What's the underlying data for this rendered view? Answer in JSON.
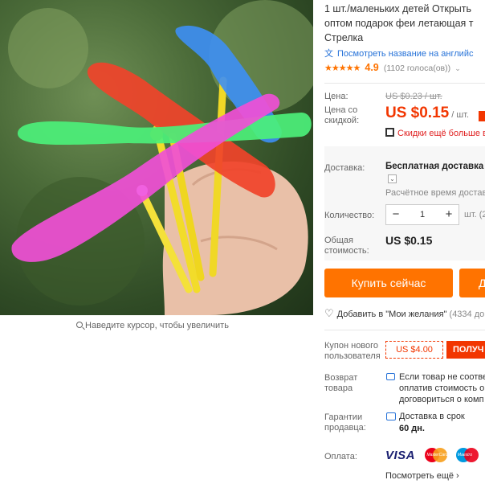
{
  "product": {
    "title_lines": [
      "1 шт./маленьких детей Открыть",
      "оптом подарок феи летающая т",
      "Стрелка"
    ],
    "translate_link": "Посмотреть название на английс",
    "rating_stars": "★★★★★",
    "rating_score": "4.9",
    "rating_votes": "(1102 голоса(ов))",
    "rating_chevron": "⌄"
  },
  "image": {
    "zoom_hint": "Наведите курсор, чтобы увеличить"
  },
  "price": {
    "label": "Цена:",
    "old": "US $0.23 / шт.",
    "discount_label": "Цена со скидкой:",
    "new": "US $0.15",
    "unit": "/ шт.",
    "qr_note": "Скидки ещё больше в"
  },
  "shipping": {
    "label": "Доставка:",
    "value": "Бесплатная доставка в",
    "checkbox": "⌄",
    "time": "Расчётное время достав"
  },
  "quantity": {
    "label": "Количество:",
    "minus": "−",
    "value": "1",
    "plus": "+",
    "unit": "шт. (2"
  },
  "total": {
    "label": "Общая стоимость:",
    "value": "US $0.15"
  },
  "actions": {
    "buy_now": "Купить сейчас",
    "add_to_cart": "Д",
    "wishlist": "Добавить в \"Мои желания\"",
    "wishlist_count": "(4334 до"
  },
  "coupon": {
    "label": "Купон нового пользователя",
    "value": "US $4.00",
    "button": "ПОЛУЧ"
  },
  "returns": {
    "label": "Возврат товара",
    "lines": [
      "Если товар не соотве",
      "оплатив стоимость о",
      "договориться о комп"
    ]
  },
  "guarantee": {
    "label": "Гарантии продавца:",
    "line1": "Доставка в срок",
    "line2": "60 дн."
  },
  "payment": {
    "label": "Оплата:",
    "visa": "VISA",
    "mastercard": "MasterCard",
    "maestro": "Maestro",
    "more": "Посмотреть ещё ›"
  },
  "colors": {
    "accent_orange": "#ff7300",
    "price_red": "#f23600",
    "link_blue": "#2672d8"
  }
}
